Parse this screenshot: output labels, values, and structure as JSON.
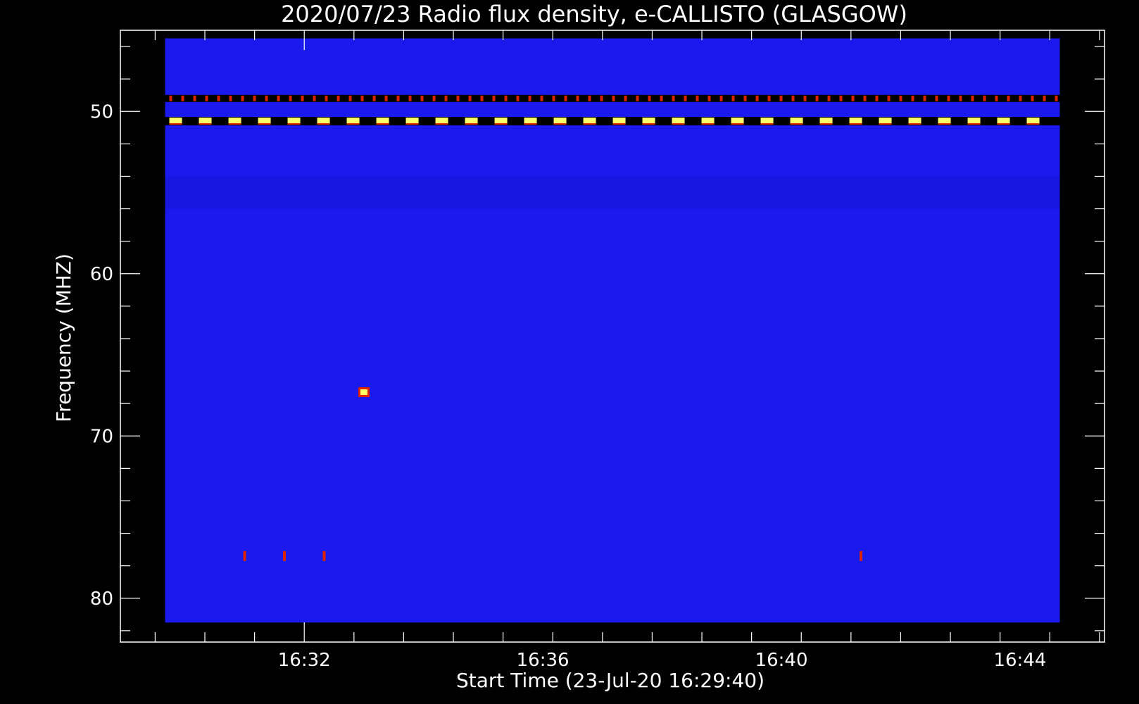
{
  "chart_data": {
    "type": "heatmap",
    "title": "2020/07/23  Radio flux density, e-CALLISTO (GLASGOW)",
    "xlabel": "Start Time (23-Jul-20 16:29:40)",
    "ylabel": "Frequency (MHZ)",
    "x_ticks": [
      "16:32",
      "16:36",
      "16:40",
      "16:44"
    ],
    "x_tick_values_min": [
      2.333,
      6.333,
      10.333,
      14.333
    ],
    "y_ticks": [
      50,
      60,
      70,
      80
    ],
    "x_range_minutes_from_start": [
      -0.75,
      15.75
    ],
    "y_range_mhz": [
      45,
      82.7
    ],
    "data_time_range_minutes_from_start": [
      0.0,
      15.0
    ],
    "data_freq_range_mhz": [
      45.5,
      81.5
    ],
    "y_inverted": true,
    "colors": {
      "background": "#1a1aee",
      "low": "#000000",
      "mid": "#dd2200",
      "high": "#ffff66"
    },
    "features": [
      {
        "name": "persistent band",
        "freq_mhz": 49.2,
        "intensity": "medium",
        "pattern": "dashed"
      },
      {
        "name": "persistent band",
        "freq_mhz": 50.6,
        "intensity": "high",
        "pattern": "dashed"
      },
      {
        "name": "spike",
        "time": "16:33",
        "freq_mhz": 67.3,
        "intensity": "high"
      },
      {
        "name": "spike",
        "time": "16:31",
        "freq_mhz": 77.4,
        "intensity": "medium"
      },
      {
        "name": "spike",
        "time": "16:31:40",
        "freq_mhz": 77.4,
        "intensity": "medium"
      },
      {
        "name": "spike",
        "time": "16:32:20",
        "freq_mhz": 77.4,
        "intensity": "medium"
      },
      {
        "name": "spike",
        "time": "16:41:20",
        "freq_mhz": 77.4,
        "intensity": "medium"
      }
    ]
  }
}
